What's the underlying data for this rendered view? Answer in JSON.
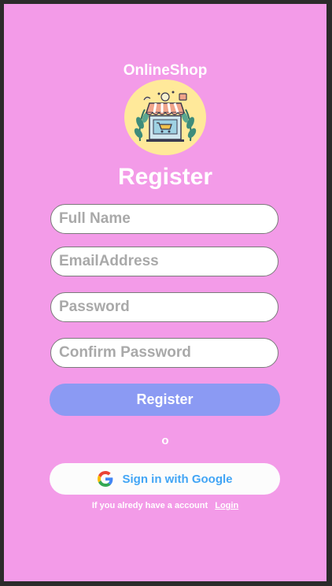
{
  "app": {
    "brand": "OnlineShop",
    "logo_icon": "shop-storefront-icon"
  },
  "page": {
    "title": "Register"
  },
  "form": {
    "full_name_placeholder": "Full Name",
    "email_placeholder": "EmailAddress",
    "password_placeholder": "Password",
    "confirm_password_placeholder": "Confirm Password",
    "register_label": "Register"
  },
  "divider": {
    "or_text": "o"
  },
  "google": {
    "label": "Sign in with Google",
    "icon": "google-g-icon"
  },
  "footer": {
    "text": "If you alredy have a account",
    "login_label": "Login"
  },
  "colors": {
    "background": "#f39be8",
    "register_button": "#8b9af3",
    "google_text": "#42a5f5",
    "logo_circle": "#ffe99a"
  }
}
